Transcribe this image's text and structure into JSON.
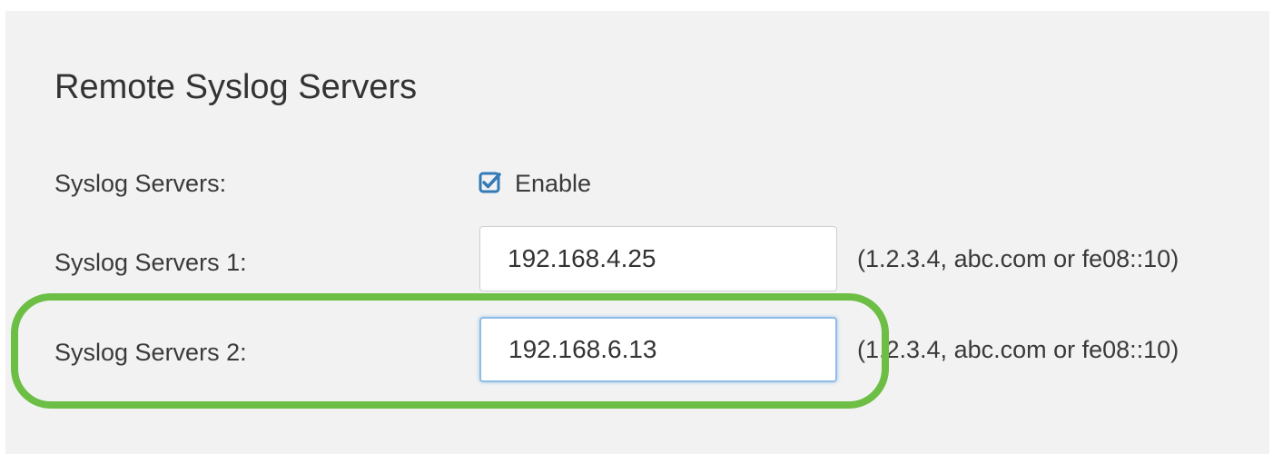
{
  "section": {
    "title": "Remote Syslog Servers"
  },
  "syslog_enable": {
    "label": "Syslog Servers:",
    "checkbox_label": "Enable",
    "checked": true,
    "checkbox_icon": "checked-square-icon"
  },
  "server1": {
    "label": "Syslog Servers 1:",
    "value": "192.168.4.25",
    "hint": "(1.2.3.4, abc.com or fe08::10)"
  },
  "server2": {
    "label": "Syslog Servers 2:",
    "value": "192.168.6.13",
    "hint": "(1.2.3.4, abc.com or fe08::10)"
  },
  "colors": {
    "panel_background": "#f2f2f2",
    "checkbox_accent": "#337ab7",
    "highlight_outline": "#6cbe45",
    "focus_border": "#8fbce6"
  }
}
